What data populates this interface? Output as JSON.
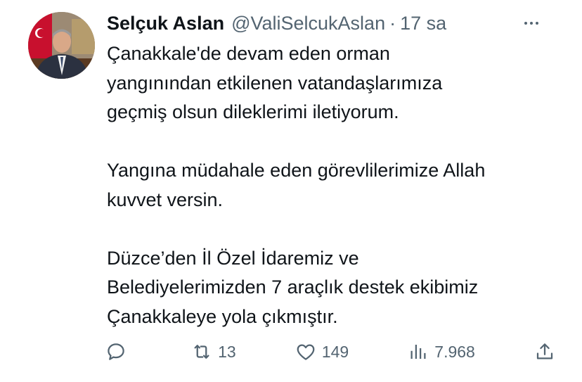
{
  "tweet": {
    "author": {
      "display_name": "Selçuk Aslan",
      "handle": "@ValiSelcukAslan",
      "separator": "·",
      "time": "17 sa"
    },
    "paragraphs": [
      [
        "Çanakkale'de devam eden orman",
        "yangınından etkilenen vatandaşlarımıza",
        "geçmiş olsun dileklerimi iletiyorum."
      ],
      [
        "Yangına müdahale eden görevlilerimize Allah",
        "kuvvet versin."
      ],
      [
        "Düzce’den İl Özel İdaremiz ve",
        "Belediyelerimizden 7 araçlık destek ekibimiz",
        "Çanakkaleye yola çıkmıştır."
      ]
    ],
    "actions": {
      "reply": {
        "icon": "reply-icon",
        "count": ""
      },
      "retweet": {
        "icon": "retweet-icon",
        "count": "13"
      },
      "like": {
        "icon": "heart-icon",
        "count": "149"
      },
      "views": {
        "icon": "views-icon",
        "count": "7.968"
      },
      "share": {
        "icon": "share-icon",
        "count": ""
      }
    },
    "colors": {
      "text": "#0f1419",
      "secondary": "#536471"
    }
  }
}
